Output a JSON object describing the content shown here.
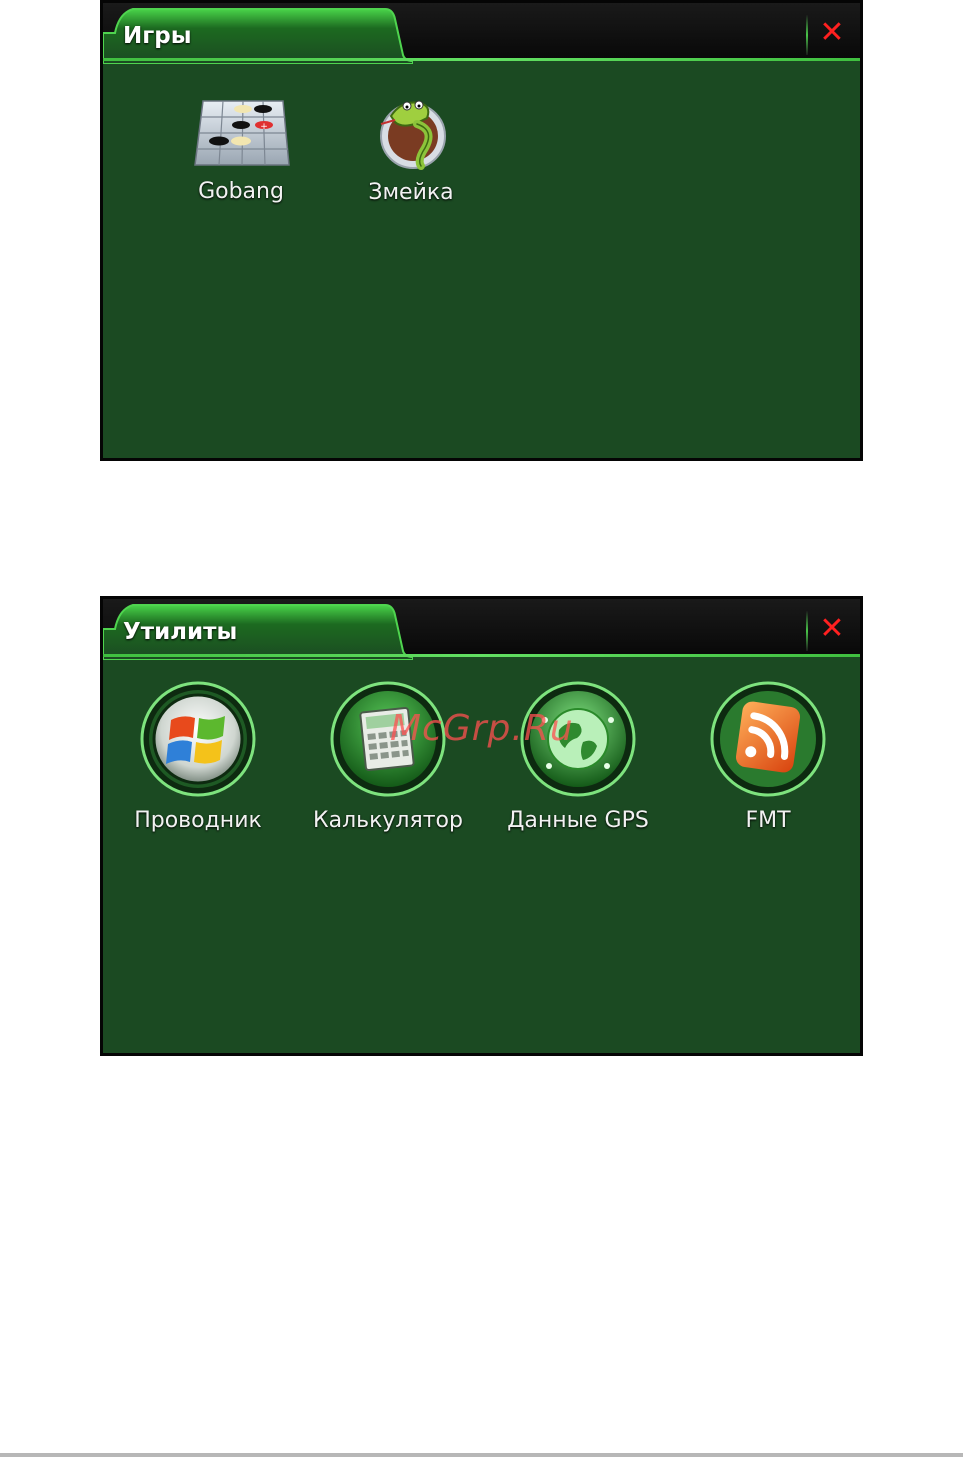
{
  "games_window": {
    "title": "Игры",
    "close_symbol": "✕",
    "apps": [
      {
        "label": "Gobang",
        "icon": "gobang-board-icon"
      },
      {
        "label": "Змейка",
        "icon": "snake-icon"
      }
    ]
  },
  "utilities_window": {
    "title": "Утилиты",
    "close_symbol": "✕",
    "apps": [
      {
        "label": "Проводник",
        "icon": "windows-explorer-icon"
      },
      {
        "label": "Калькулятор",
        "icon": "calculator-icon"
      },
      {
        "label": "Данные GPS",
        "icon": "gps-globe-icon"
      },
      {
        "label": "FMT",
        "icon": "rss-feed-icon"
      }
    ]
  },
  "watermark": "McGrp.Ru",
  "colors": {
    "window_bg": "#1b4a22",
    "tab_green": "#3fbf3f",
    "close_red": "#ff2020"
  }
}
